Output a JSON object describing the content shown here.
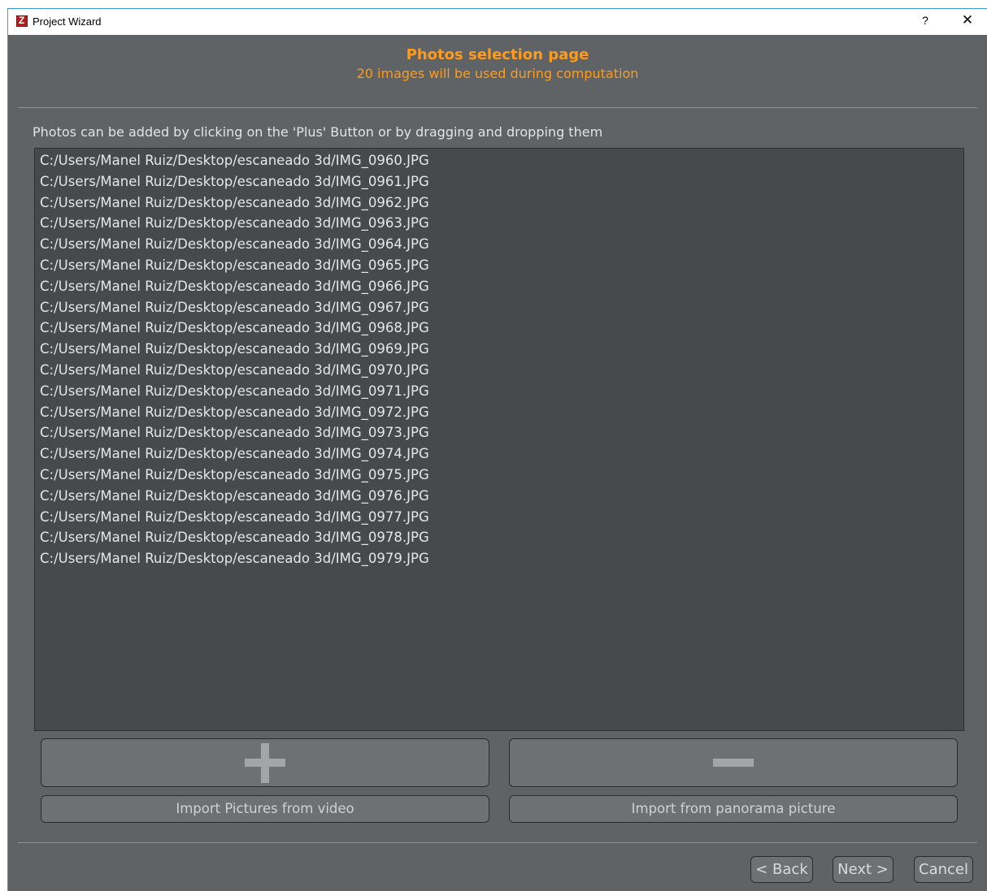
{
  "window": {
    "title": "Project Wizard",
    "help_label": "?",
    "close_label": "✕"
  },
  "header": {
    "title": "Photos selection page",
    "subtitle": "20 images will be used during computation"
  },
  "instruction": "Photos can be added by clicking on the 'Plus' Button or by dragging and dropping them",
  "photos": [
    "C:/Users/Manel Ruiz/Desktop/escaneado 3d/IMG_0960.JPG",
    "C:/Users/Manel Ruiz/Desktop/escaneado 3d/IMG_0961.JPG",
    "C:/Users/Manel Ruiz/Desktop/escaneado 3d/IMG_0962.JPG",
    "C:/Users/Manel Ruiz/Desktop/escaneado 3d/IMG_0963.JPG",
    "C:/Users/Manel Ruiz/Desktop/escaneado 3d/IMG_0964.JPG",
    "C:/Users/Manel Ruiz/Desktop/escaneado 3d/IMG_0965.JPG",
    "C:/Users/Manel Ruiz/Desktop/escaneado 3d/IMG_0966.JPG",
    "C:/Users/Manel Ruiz/Desktop/escaneado 3d/IMG_0967.JPG",
    "C:/Users/Manel Ruiz/Desktop/escaneado 3d/IMG_0968.JPG",
    "C:/Users/Manel Ruiz/Desktop/escaneado 3d/IMG_0969.JPG",
    "C:/Users/Manel Ruiz/Desktop/escaneado 3d/IMG_0970.JPG",
    "C:/Users/Manel Ruiz/Desktop/escaneado 3d/IMG_0971.JPG",
    "C:/Users/Manel Ruiz/Desktop/escaneado 3d/IMG_0972.JPG",
    "C:/Users/Manel Ruiz/Desktop/escaneado 3d/IMG_0973.JPG",
    "C:/Users/Manel Ruiz/Desktop/escaneado 3d/IMG_0974.JPG",
    "C:/Users/Manel Ruiz/Desktop/escaneado 3d/IMG_0975.JPG",
    "C:/Users/Manel Ruiz/Desktop/escaneado 3d/IMG_0976.JPG",
    "C:/Users/Manel Ruiz/Desktop/escaneado 3d/IMG_0977.JPG",
    "C:/Users/Manel Ruiz/Desktop/escaneado 3d/IMG_0978.JPG",
    "C:/Users/Manel Ruiz/Desktop/escaneado 3d/IMG_0979.JPG"
  ],
  "buttons": {
    "add_icon": "plus-icon",
    "remove_icon": "minus-icon",
    "import_video": "Import Pictures from video",
    "import_panorama": "Import from panorama picture"
  },
  "nav": {
    "back": "< Back",
    "next": "Next >",
    "cancel": "Cancel"
  },
  "colors": {
    "accent": "#ff9b1a",
    "background": "#5f6366",
    "list_background": "#474a4d"
  }
}
